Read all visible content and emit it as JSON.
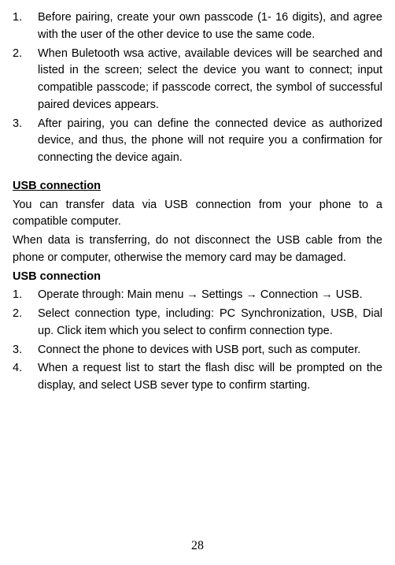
{
  "list1": [
    {
      "num": "1.",
      "text": "Before pairing, create your own passcode (1- 16 digits), and agree with the user of the other device to use the same code."
    },
    {
      "num": "2.",
      "text": "When Buletooth wsa active, available devices will be searched and listed in the screen; select the device you want to connect; input compatible passcode; if passcode correct, the symbol of successful paired devices appears."
    },
    {
      "num": "3.",
      "text": "After pairing, you can define the connected device as authorized device, and thus, the phone will not require you a confirmation for connecting the device again."
    }
  ],
  "usb_heading": "USB connection",
  "usb_p1": "You can transfer data via USB connection from your phone to a compatible computer.",
  "usb_p2": "When data is transferring, do not disconnect the USB cable from the phone or computer, otherwise the memory card may be damaged.",
  "usb_subheading": "USB connection",
  "list2": [
    {
      "num": "1.",
      "text": "Operate through: Main menu → Settings → Connection → USB."
    },
    {
      "num": "2.",
      "text": "Select connection type, including: PC Synchronization, USB, Dial up. Click item which you select to confirm connection type."
    },
    {
      "num": "3.",
      "text": "Connect the phone to devices with USB port, such as computer."
    },
    {
      "num": "4.",
      "text": "When a request list to start the flash disc will be prompted on the display, and select USB sever type to confirm starting."
    }
  ],
  "page_number": "28"
}
